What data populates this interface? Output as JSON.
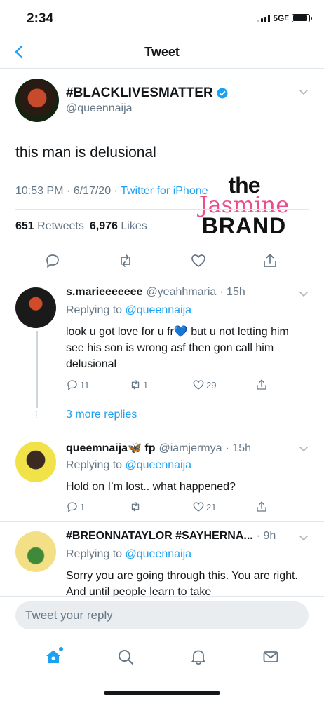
{
  "status_bar": {
    "time": "2:34",
    "network": "5G",
    "network_suffix": "E"
  },
  "nav": {
    "title": "Tweet",
    "back_icon": "chevron-left-icon"
  },
  "main_tweet": {
    "display_name": "#BLACKLIVESMATTER",
    "handle": "@queennaija",
    "text": "this man is delusional",
    "timestamp": "10:53 PM · 6/17/20 · ",
    "source": "Twitter for iPhone",
    "retweets_count": "651",
    "retweets_label": "Retweets",
    "likes_count": "6,976",
    "likes_label": "Likes"
  },
  "watermark": {
    "line1": "the",
    "line2": "Jasmine",
    "line3": "BRAND"
  },
  "replies": [
    {
      "display_name": "s.marieeeeeee",
      "handle": "@yeahhmaria",
      "time": "· 15h",
      "replying_prefix": "Replying to ",
      "replying_to": "@queennaija",
      "text": "look u got love for u fr💙 but u not letting him see his son is wrong asf then gon call him delusional",
      "replies": "11",
      "retweets": "1",
      "likes": "29"
    },
    {
      "display_name": "queemnaija🦋 fp",
      "handle": "@iamjermya",
      "time": "· 15h",
      "replying_prefix": "Replying to ",
      "replying_to": "@queennaija",
      "text": "Hold on I’m lost.. what happened?",
      "replies": "1",
      "retweets": "",
      "likes": "21"
    },
    {
      "display_name": "#BREONNATAYLOR #SAYHERNA...",
      "handle": "",
      "time": "· 9h",
      "replying_prefix": "Replying to ",
      "replying_to": "@queennaija",
      "text": "Sorry you are going through this. You are right. And until people learn to take"
    }
  ],
  "more_replies": "3 more replies",
  "composer": {
    "placeholder": "Tweet your reply"
  },
  "colors": {
    "accent": "#1da1f2",
    "secondary_text": "#657786",
    "divider": "#e1e8ed"
  }
}
